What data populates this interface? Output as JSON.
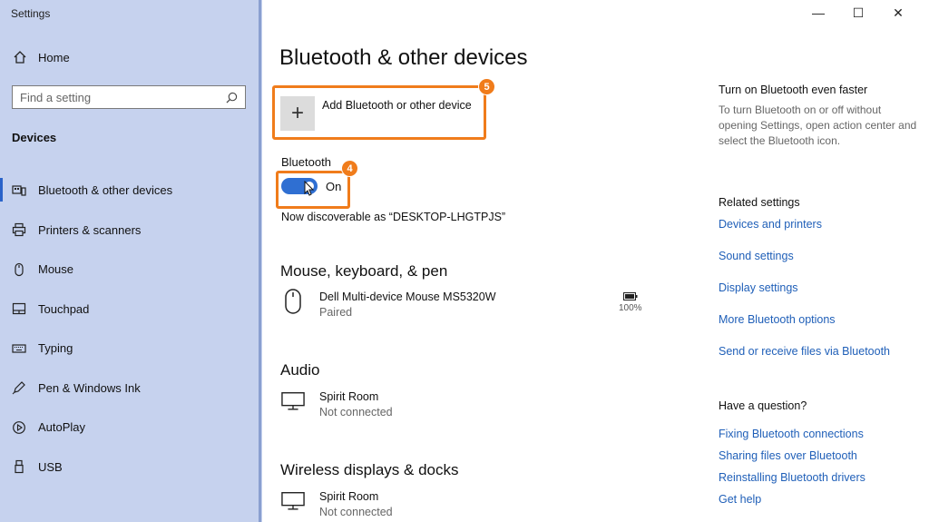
{
  "window": {
    "title": "Settings",
    "minimize": "—",
    "maximize": "☐",
    "close": "✕"
  },
  "sidebar": {
    "home_label": "Home",
    "search_placeholder": "Find a setting",
    "section": "Devices",
    "items": [
      {
        "label": "Bluetooth & other devices",
        "icon": "bluetooth-devices-icon",
        "active": true
      },
      {
        "label": "Printers & scanners",
        "icon": "printer-icon"
      },
      {
        "label": "Mouse",
        "icon": "mouse-icon"
      },
      {
        "label": "Touchpad",
        "icon": "touchpad-icon"
      },
      {
        "label": "Typing",
        "icon": "keyboard-icon"
      },
      {
        "label": "Pen & Windows Ink",
        "icon": "pen-icon"
      },
      {
        "label": "AutoPlay",
        "icon": "autoplay-icon"
      },
      {
        "label": "USB",
        "icon": "usb-icon"
      }
    ]
  },
  "main": {
    "title": "Bluetooth & other devices",
    "add_device_label": "Add Bluetooth or other device",
    "add_plus": "+",
    "badge_add": "5",
    "bluetooth_label": "Bluetooth",
    "toggle_state": "On",
    "badge_toggle": "4",
    "discoverable": "Now discoverable as “DESKTOP-LHGTPJS”",
    "mouse_section": "Mouse, keyboard, & pen",
    "mouse_device": {
      "name": "Dell Multi-device Mouse MS5320W",
      "status": "Paired",
      "battery": "100%"
    },
    "audio_section": "Audio",
    "audio_device": {
      "name": "Spirit Room",
      "status": "Not connected"
    },
    "wireless_section": "Wireless displays & docks",
    "wireless_device": {
      "name": "Spirit Room",
      "status": "Not connected"
    }
  },
  "right": {
    "tip_title": "Turn on Bluetooth even faster",
    "tip_text": "To turn Bluetooth on or off without opening Settings, open action center and select the Bluetooth icon.",
    "related_title": "Related settings",
    "related_links": [
      "Devices and printers",
      "Sound settings",
      "Display settings",
      "More Bluetooth options",
      "Send or receive files via Bluetooth"
    ],
    "question_title": "Have a question?",
    "help_links": [
      "Fixing Bluetooth connections",
      "Sharing files over Bluetooth",
      "Reinstalling Bluetooth drivers",
      "Get help"
    ]
  },
  "colors": {
    "accent": "#2f6fd2",
    "highlight": "#f07c1b",
    "sidebar_bg": "#c6d2ee",
    "link": "#1f5fb8"
  }
}
